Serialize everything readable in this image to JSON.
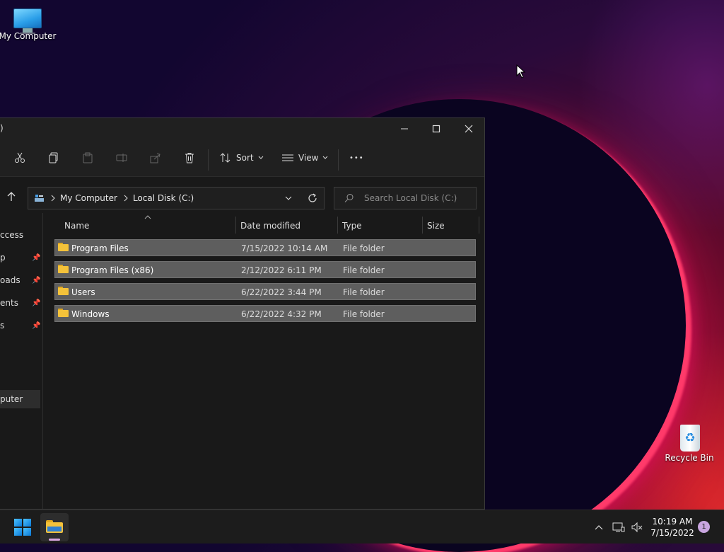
{
  "desktop": {
    "icons": [
      {
        "label": "My Computer"
      },
      {
        "label": "Recycle Bin"
      }
    ]
  },
  "window": {
    "title": ")",
    "controls": {
      "minimize": "—",
      "maximize": "☐",
      "close": "✕"
    },
    "toolbar": {
      "sort_label": "Sort",
      "view_label": "View",
      "more_label": "•••"
    },
    "address": {
      "crumbs": [
        "My Computer",
        "Local Disk (C:)"
      ]
    },
    "search": {
      "placeholder": "Search Local Disk (C:)"
    },
    "sidebar": {
      "items": [
        {
          "label": "ccess",
          "pinned": false
        },
        {
          "label": "p",
          "pinned": true
        },
        {
          "label": "oads",
          "pinned": true
        },
        {
          "label": "ents",
          "pinned": true
        },
        {
          "label": "s",
          "pinned": true
        },
        {
          "label": "puter",
          "pinned": false
        }
      ]
    },
    "columns": {
      "name": "Name",
      "date": "Date modified",
      "type": "Type",
      "size": "Size"
    },
    "files": [
      {
        "name": "Program Files",
        "date": "7/15/2022 10:14 AM",
        "type": "File folder"
      },
      {
        "name": "Program Files (x86)",
        "date": "2/12/2022 6:11 PM",
        "type": "File folder"
      },
      {
        "name": "Users",
        "date": "6/22/2022 3:44 PM",
        "type": "File folder"
      },
      {
        "name": "Windows",
        "date": "6/22/2022 4:32 PM",
        "type": "File folder"
      }
    ]
  },
  "taskbar": {
    "time": "10:19 AM",
    "date": "7/15/2022",
    "notification_count": "1"
  }
}
